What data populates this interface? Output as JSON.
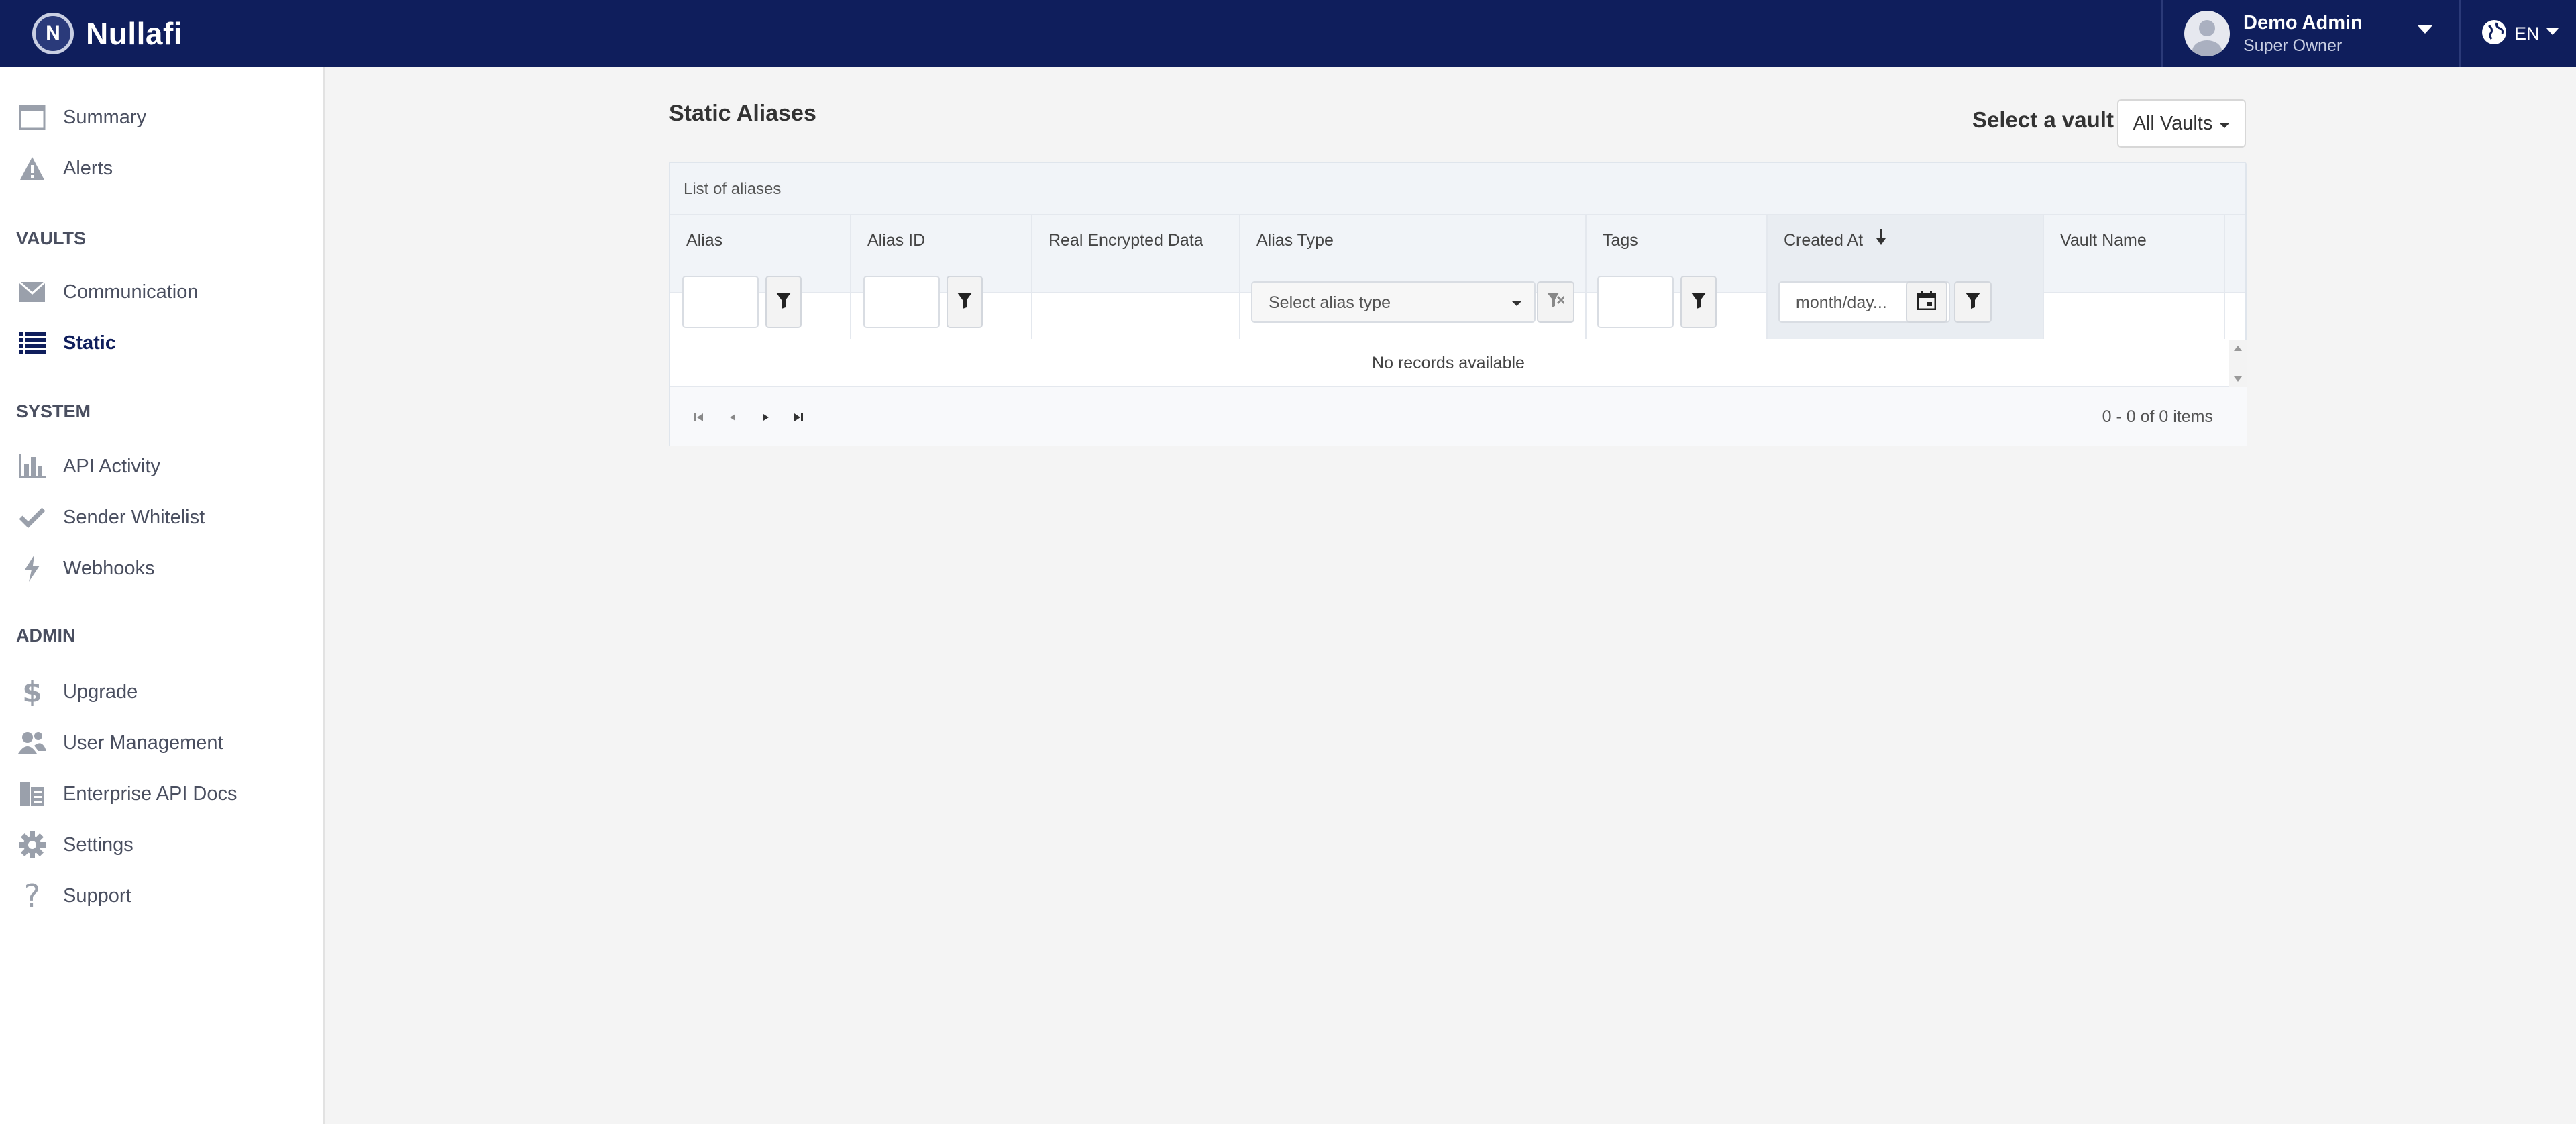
{
  "app": {
    "brand": "Nullafi",
    "logo_letter": "N"
  },
  "user": {
    "name": "Demo Admin",
    "role": "Super Owner"
  },
  "language": {
    "current": "EN"
  },
  "sidebar": {
    "top_items": [
      {
        "label": "Summary",
        "icon": "window-icon"
      },
      {
        "label": "Alerts",
        "icon": "warning-icon"
      }
    ],
    "sections": [
      {
        "title": "VAULTS",
        "items": [
          {
            "label": "Communication",
            "icon": "envelope-icon"
          },
          {
            "label": "Static",
            "icon": "list-icon",
            "active": true
          }
        ]
      },
      {
        "title": "SYSTEM",
        "items": [
          {
            "label": "API Activity",
            "icon": "bar-chart-icon"
          },
          {
            "label": "Sender Whitelist",
            "icon": "checkmark-icon"
          },
          {
            "label": "Webhooks",
            "icon": "lightning-icon"
          }
        ]
      },
      {
        "title": "ADMIN",
        "items": [
          {
            "label": "Upgrade",
            "icon": "dollar-icon"
          },
          {
            "label": "User Management",
            "icon": "users-icon"
          },
          {
            "label": "Enterprise API Docs",
            "icon": "document-icon"
          },
          {
            "label": "Settings",
            "icon": "gear-icon"
          },
          {
            "label": "Support",
            "icon": "question-icon"
          }
        ]
      }
    ]
  },
  "main": {
    "title": "Static Aliases",
    "vault_label": "Select a vault",
    "vault_selected": "All Vaults"
  },
  "grid": {
    "caption": "List of aliases",
    "columns": [
      "Alias",
      "Alias ID",
      "Real Encrypted Data",
      "Alias Type",
      "Tags",
      "Created At",
      "Vault Name"
    ],
    "alias_type_placeholder": "Select alias type",
    "date_placeholder": "month/day...",
    "empty_text": "No records available",
    "pager_info": "0 - 0 of 0 items"
  },
  "colors": {
    "topbar": "#0f1e5c",
    "accent": "#0f1e5c"
  }
}
